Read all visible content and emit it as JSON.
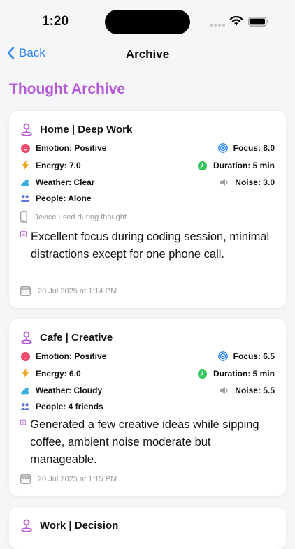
{
  "status": {
    "time": "1:20"
  },
  "nav": {
    "back_label": "Back",
    "title": "Archive"
  },
  "page_title": "Thought Archive",
  "cards": [
    {
      "location": "Home | Deep Work",
      "emotion": "Emotion: Positive",
      "focus": "Focus: 8.0",
      "energy": "Energy: 7.0",
      "duration": "Duration: 5 min",
      "weather": "Weather: Clear",
      "noise": "Noise: 3.0",
      "people": "People: Alone",
      "device": "Device used during thought",
      "note": "Excellent focus during coding session, minimal distractions except for one phone call.",
      "date": "20 Jul 2025 at 1:14 PM"
    },
    {
      "location": "Cafe | Creative",
      "emotion": "Emotion: Positive",
      "focus": "Focus: 6.5",
      "energy": "Energy: 6.0",
      "duration": "Duration: 5 min",
      "weather": "Weather: Cloudy",
      "noise": "Noise: 5.5",
      "people": "People: 4 friends",
      "note": "Generated a few creative ideas while sipping coffee, ambient noise moderate but manageable.",
      "date": "20 Jul 2025 at 1:15 PM"
    },
    {
      "location": "Work | Decision"
    }
  ],
  "colors": {
    "accent": "#b45ad6",
    "link": "#2d86f2",
    "emotion": "#f0476b",
    "focus": "#2d86f2",
    "energy": "#f5a623",
    "duration": "#34c759",
    "weather": "#38b0de",
    "people": "#5a6fd6"
  }
}
